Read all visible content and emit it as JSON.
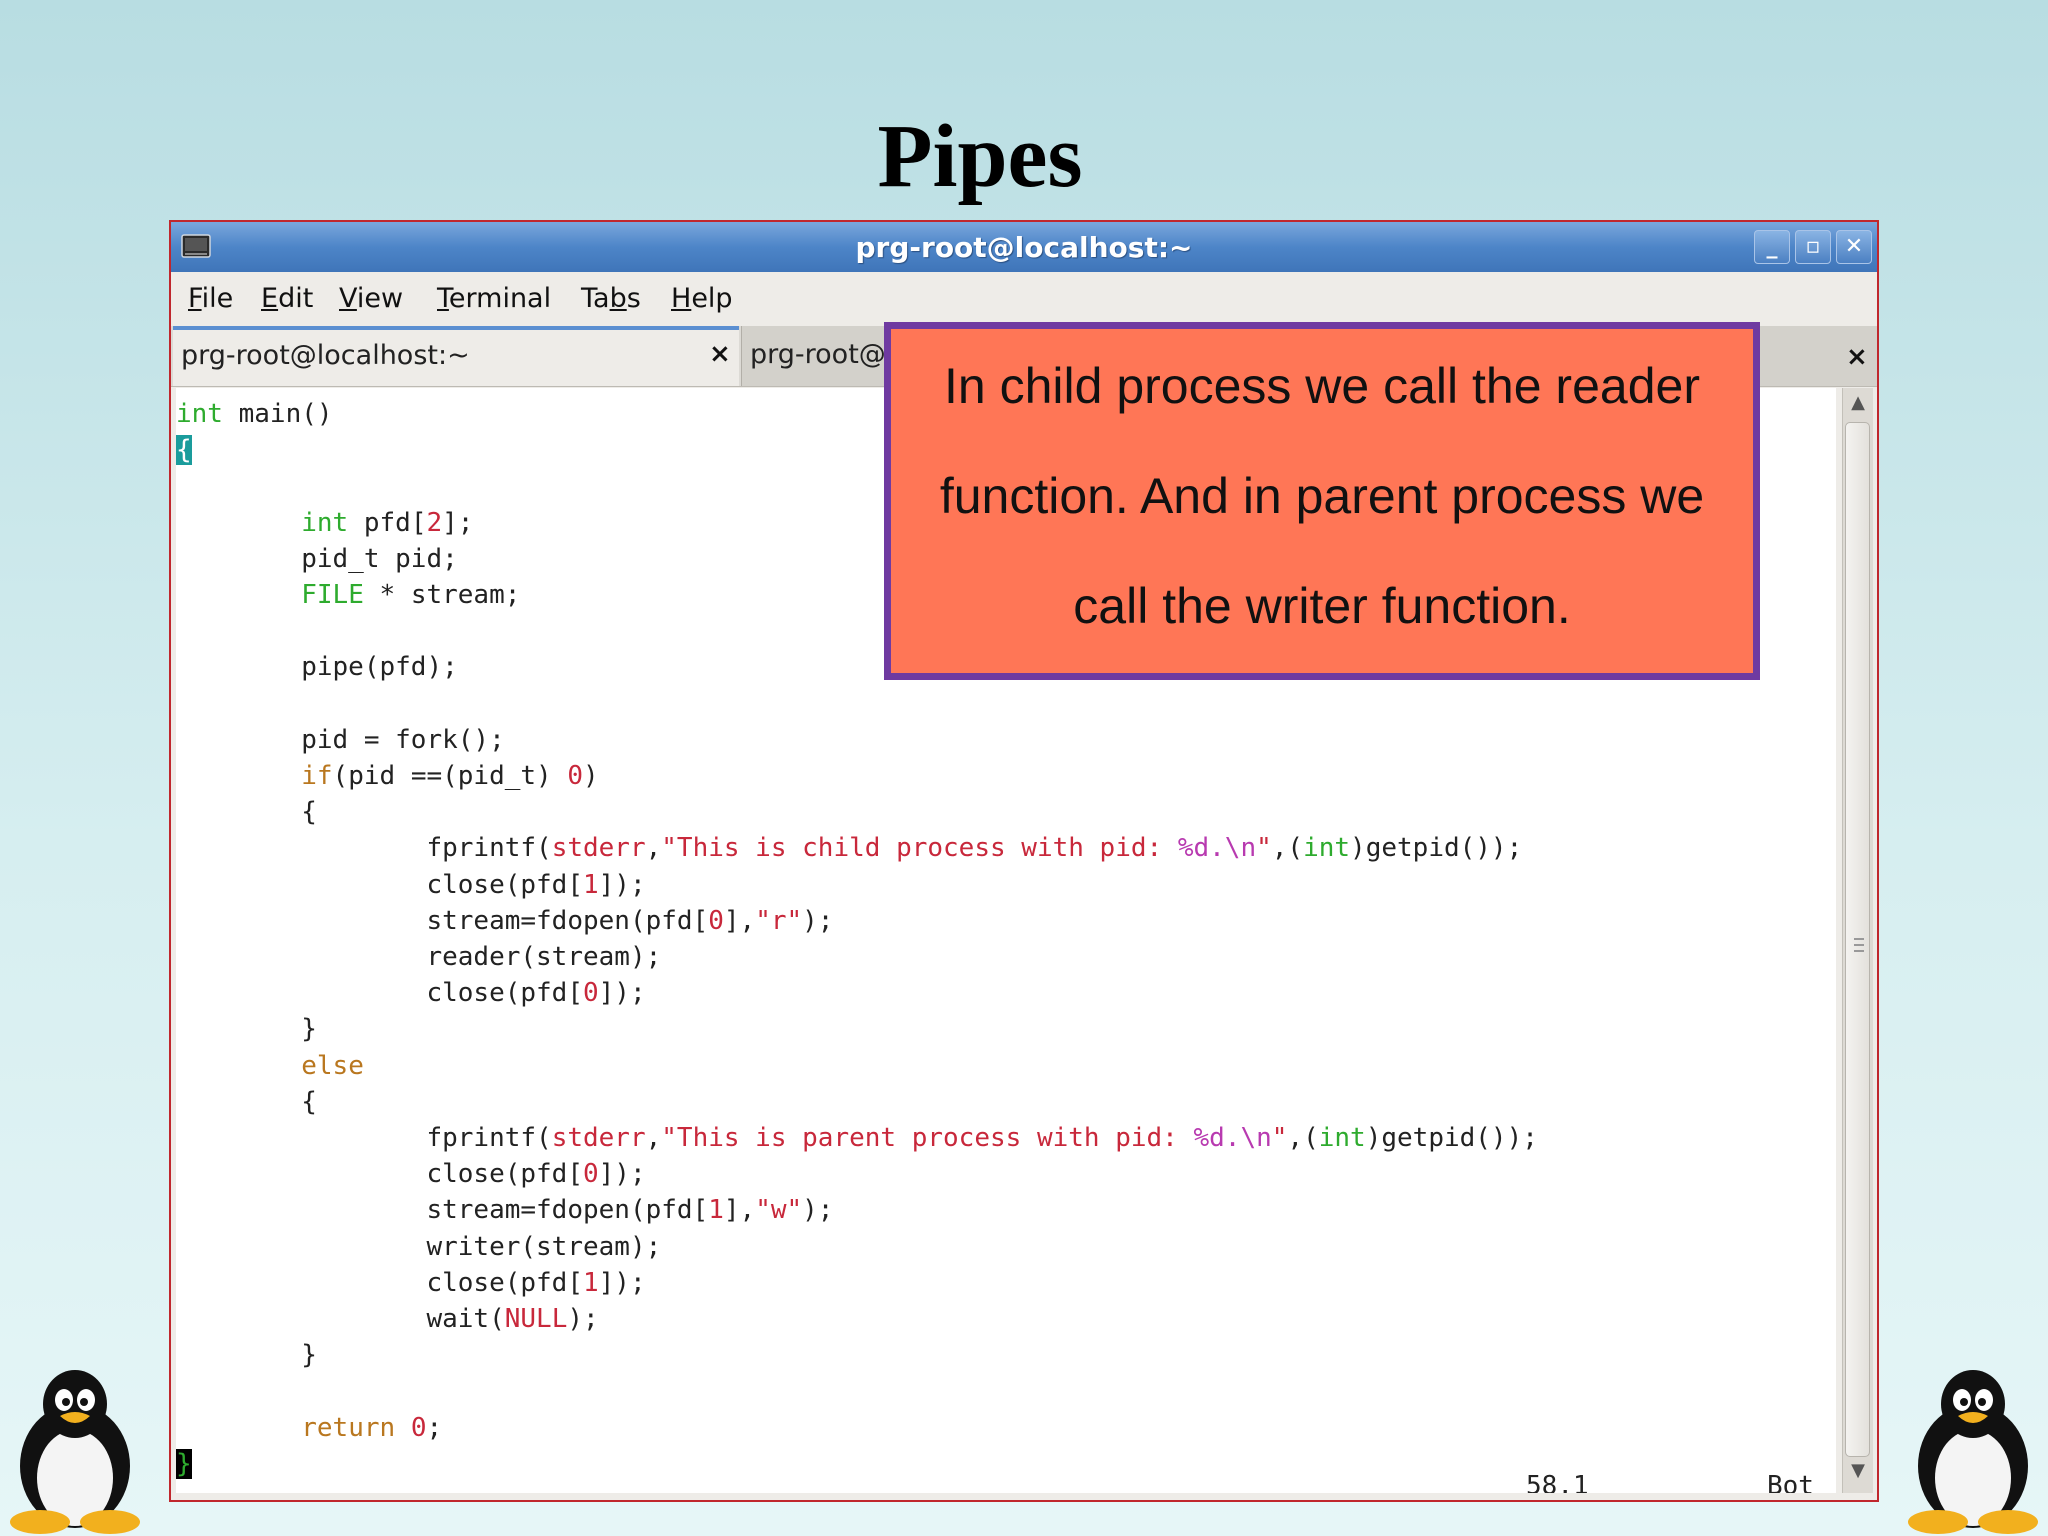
{
  "slide": {
    "title": "Pipes"
  },
  "window": {
    "title": "prg-root@localhost:~",
    "buttons": {
      "minimize": "_",
      "maximize": "▫",
      "close": "✕"
    }
  },
  "menu": [
    {
      "mnemonic": "F",
      "rest": "ile"
    },
    {
      "mnemonic": "E",
      "rest": "dit"
    },
    {
      "mnemonic": "V",
      "rest": "iew"
    },
    {
      "mnemonic": "T",
      "rest": "erminal"
    },
    {
      "pre": "Ta",
      "mnemonic": "b",
      "rest": "s"
    },
    {
      "mnemonic": "H",
      "rest": "elp"
    }
  ],
  "tabs": [
    {
      "label": "prg-root@localhost:~",
      "close": "×"
    },
    {
      "label": "prg-root@",
      "close": "×"
    }
  ],
  "terminal": {
    "status_position": "58,1",
    "status_scroll": "Bot"
  },
  "callout": {
    "lines": [
      "In child process we call the reader",
      "function. And in parent process we",
      "call the writer function."
    ]
  },
  "colors": {
    "callout_fill": "#ff7656",
    "callout_border": "#6f3aa1",
    "window_border": "#c0272d",
    "titlebar": "#4d85c8"
  },
  "icons": {
    "titlebar": "terminal-icon",
    "left_mascot": "tux-penguin-icon",
    "right_mascot": "tux-penguin-icon"
  }
}
